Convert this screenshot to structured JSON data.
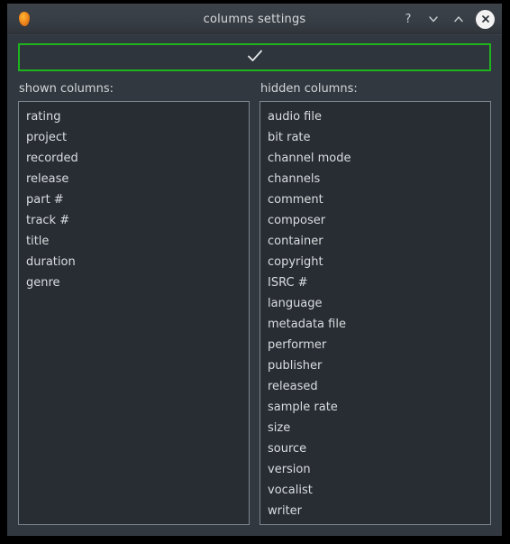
{
  "window": {
    "title": "columns settings",
    "app_icon": "flame-icon",
    "buttons": [
      {
        "name": "help-button",
        "icon": "question-mark-icon",
        "glyph": "?"
      },
      {
        "name": "minimize-button",
        "icon": "chevron-down-icon",
        "glyph": "∨"
      },
      {
        "name": "maximize-button",
        "icon": "chevron-up-icon",
        "glyph": "∧"
      },
      {
        "name": "close-button",
        "icon": "close-x-icon",
        "glyph": "×"
      }
    ]
  },
  "toolbar": {
    "apply_icon": "checkmark-icon",
    "apply_label": "",
    "accent_color": "#1eb41e"
  },
  "shown": {
    "label": "shown columns:",
    "items": [
      "rating",
      "project",
      "recorded",
      "release",
      "part #",
      "track #",
      "title",
      "duration",
      "genre"
    ]
  },
  "hidden": {
    "label": "hidden columns:",
    "items": [
      "audio file",
      "bit rate",
      "channel mode",
      "channels",
      "comment",
      "composer",
      "container",
      "copyright",
      "ISRC #",
      "language",
      "metadata file",
      "performer",
      "publisher",
      "released",
      "sample rate",
      "size",
      "source",
      "version",
      "vocalist",
      "writer"
    ]
  },
  "colors": {
    "window_bg": "#32383f",
    "list_bg": "#282d34",
    "list_border": "#7d858d",
    "text": "#d9dde0",
    "accent_green": "#1eb41e",
    "titlebar_top": "#3c4249",
    "titlebar_bottom": "#2f343b"
  }
}
